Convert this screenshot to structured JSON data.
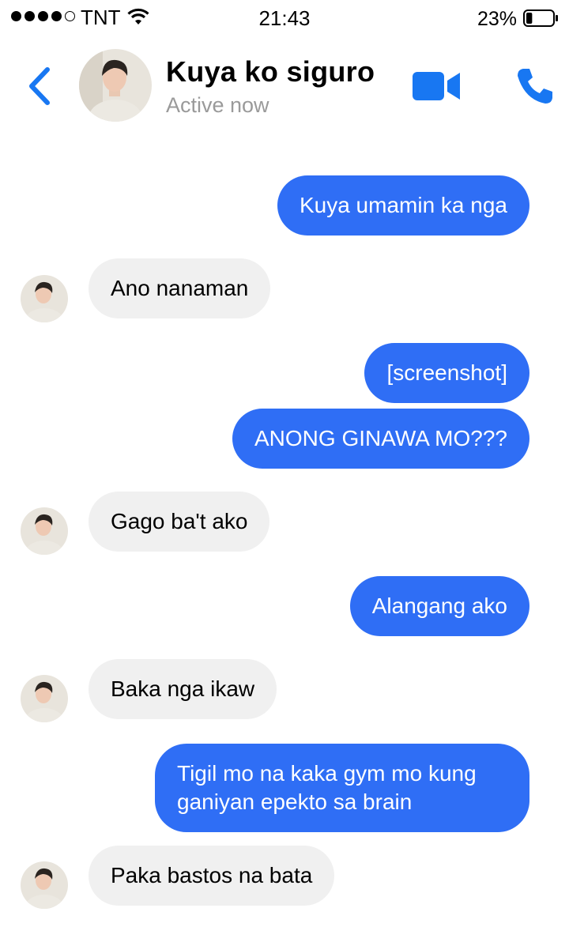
{
  "status_bar": {
    "carrier": "TNT",
    "time": "21:43",
    "battery_percent": "23%",
    "battery_level": 0.23,
    "signal_bars_filled": 4,
    "signal_bars_total": 5
  },
  "header": {
    "contact_name": "Kuya ko siguro",
    "contact_status": "Active now",
    "icons": [
      "chevron-left-icon",
      "video-camera-icon",
      "phone-icon"
    ],
    "accent_color": "#1877f2"
  },
  "messages": [
    {
      "direction": "outgoing",
      "text": "Kuya umamin ka nga"
    },
    {
      "direction": "incoming",
      "text": "Ano nanaman"
    },
    {
      "direction": "outgoing",
      "text": "[screenshot]"
    },
    {
      "direction": "outgoing",
      "text": "ANONG GINAWA MO???"
    },
    {
      "direction": "incoming",
      "text": "Gago ba't ako"
    },
    {
      "direction": "outgoing",
      "text": "Alangang ako"
    },
    {
      "direction": "incoming",
      "text": "Baka nga ikaw"
    },
    {
      "direction": "outgoing",
      "text": "Tigil mo na kaka gym mo kung ganiyan epekto sa brain"
    },
    {
      "direction": "incoming",
      "text": "Paka bastos na bata"
    }
  ],
  "colors": {
    "outgoing_bubble": "#2f6ef5",
    "incoming_bubble": "#f0f0f0",
    "status_text": "#9a9a9a"
  }
}
